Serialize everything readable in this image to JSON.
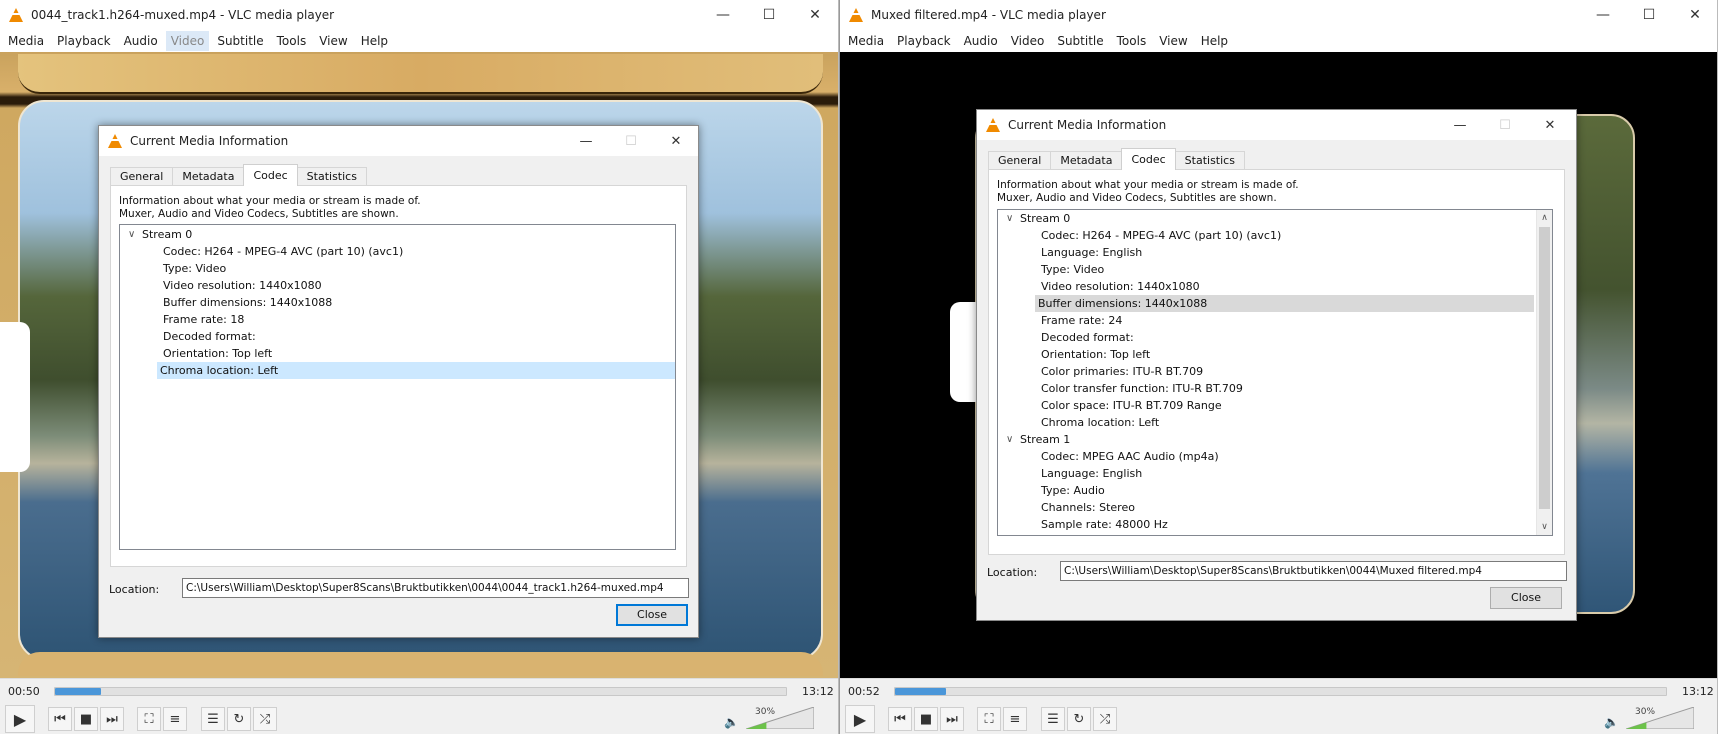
{
  "left": {
    "title": "0044_track1.h264-muxed.mp4 - VLC media player",
    "menu": [
      "Media",
      "Playback",
      "Audio",
      "Video",
      "Subtitle",
      "Tools",
      "View",
      "Help"
    ],
    "active_menu_index": 3,
    "time_elapsed": "00:50",
    "time_total": "13:12",
    "progress": 0.063,
    "volume_label": "30%",
    "volume": 0.3,
    "dialog": {
      "title": "Current Media Information",
      "tabs": [
        "General",
        "Metadata",
        "Codec",
        "Statistics"
      ],
      "selected_tab": "Codec",
      "info_line1": "Information about what your media or stream is made of.",
      "info_line2": "Muxer, Audio and Video Codecs, Subtitles are shown.",
      "streams": [
        {
          "name": "Stream 0",
          "items": [
            "Codec: H264 - MPEG-4 AVC (part 10) (avc1)",
            "Type: Video",
            "Video resolution: 1440x1080",
            "Buffer dimensions: 1440x1088",
            "Frame rate: 18",
            "Decoded format:",
            "Orientation: Top left",
            "Chroma location: Left"
          ]
        }
      ],
      "highlighted_item": "Chroma location: Left",
      "location_label": "Location:",
      "location_value": "C:\\Users\\William\\Desktop\\Super8Scans\\Bruktbutikken\\0044\\0044_track1.h264-muxed.mp4",
      "close_label": "Close"
    }
  },
  "right": {
    "title": "Muxed filtered.mp4 - VLC media player",
    "menu": [
      "Media",
      "Playback",
      "Audio",
      "Video",
      "Subtitle",
      "Tools",
      "View",
      "Help"
    ],
    "time_elapsed": "00:52",
    "time_total": "13:12",
    "progress": 0.066,
    "volume_label": "30%",
    "volume": 0.3,
    "dialog": {
      "title": "Current Media Information",
      "tabs": [
        "General",
        "Metadata",
        "Codec",
        "Statistics"
      ],
      "selected_tab": "Codec",
      "info_line1": "Information about what your media or stream is made of.",
      "info_line2": "Muxer, Audio and Video Codecs, Subtitles are shown.",
      "streams": [
        {
          "name": "Stream 0",
          "items": [
            "Codec: H264 - MPEG-4 AVC (part 10) (avc1)",
            "Language: English",
            "Type: Video",
            "Video resolution: 1440x1080",
            "Buffer dimensions: 1440x1088",
            "Frame rate: 24",
            "Decoded format:",
            "Orientation: Top left",
            "Color primaries: ITU-R BT.709",
            "Color transfer function: ITU-R BT.709",
            "Color space: ITU-R BT.709 Range",
            "Chroma location: Left"
          ]
        },
        {
          "name": "Stream 1",
          "items": [
            "Codec: MPEG AAC Audio (mp4a)",
            "Language: English",
            "Type: Audio",
            "Channels: Stereo",
            "Sample rate: 48000 Hz"
          ]
        }
      ],
      "highlighted_item": "Buffer dimensions: 1440x1088",
      "location_label": "Location:",
      "location_value": "C:\\Users\\William\\Desktop\\Super8Scans\\Bruktbutikken\\0044\\Muxed filtered.mp4",
      "close_label": "Close"
    }
  },
  "icons": {
    "minimize": "minimize-icon",
    "maximize": "maximize-icon",
    "close": "close-icon",
    "play": "play-icon",
    "prev": "previous-icon",
    "stop": "stop-icon",
    "next": "next-icon",
    "fullscreen": "fullscreen-icon",
    "extended": "extended-settings-icon",
    "playlist": "playlist-icon",
    "loop": "loop-icon",
    "shuffle": "shuffle-icon",
    "speaker": "speaker-icon"
  },
  "colors": {
    "accent": "#4a96d9",
    "vlc_orange": "#f08a00",
    "selection_blue": "#cce8ff",
    "selection_gray": "#d9d9d9"
  }
}
